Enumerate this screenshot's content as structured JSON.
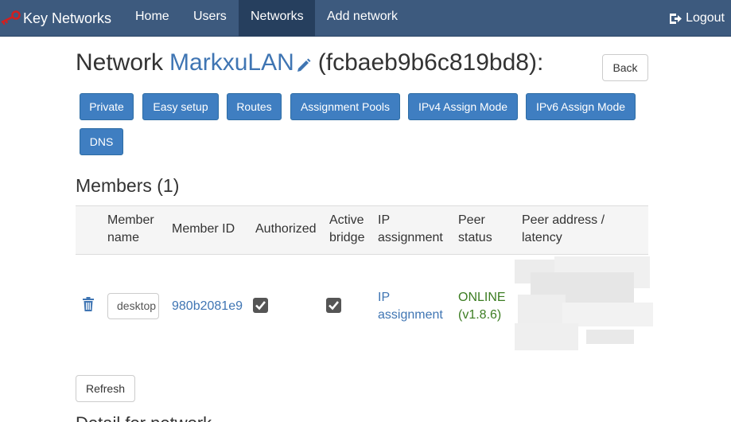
{
  "navbar": {
    "brand": "Key Networks",
    "items": [
      {
        "label": "Home"
      },
      {
        "label": "Users"
      },
      {
        "label": "Networks"
      },
      {
        "label": "Add network"
      }
    ],
    "logout_label": "Logout"
  },
  "page": {
    "title_prefix": "Network",
    "network_name": "MarkxuLAN",
    "network_id": "(fcbaeb9b6c819bd8):",
    "back_label": "Back"
  },
  "toolbar": {
    "buttons": [
      {
        "label": "Private"
      },
      {
        "label": "Easy setup"
      },
      {
        "label": "Routes"
      },
      {
        "label": "Assignment Pools"
      },
      {
        "label": "IPv4 Assign Mode"
      },
      {
        "label": "IPv6 Assign Mode"
      },
      {
        "label": "DNS"
      }
    ]
  },
  "members": {
    "heading": "Members (1)",
    "columns": [
      {
        "line1": "Member",
        "line2": "name"
      },
      {
        "line1": "Member ID",
        "line2": ""
      },
      {
        "line1": "Authorized",
        "line2": ""
      },
      {
        "line1": "Active",
        "line2": "bridge"
      },
      {
        "line1": "IP",
        "line2": "assignment"
      },
      {
        "line1": "Peer",
        "line2": "status"
      },
      {
        "line1": "Peer address /",
        "line2": "latency"
      }
    ],
    "rows": [
      {
        "name_value": "desktop",
        "member_id": "980b2081e9",
        "authorized": true,
        "active_bridge": true,
        "ip_link_line1": "IP",
        "ip_link_line2": "assignment",
        "status_line1": "ONLINE",
        "status_line2": "(v1.8.6)"
      }
    ],
    "refresh_label": "Refresh"
  },
  "footer": {
    "next_heading": "Detail for network"
  },
  "colors": {
    "navbar": "#3d5a7e",
    "navbar_active": "#263f5e",
    "primary_button": "#3f7ec1",
    "link": "#3f75b3",
    "online": "#3c7d22"
  }
}
